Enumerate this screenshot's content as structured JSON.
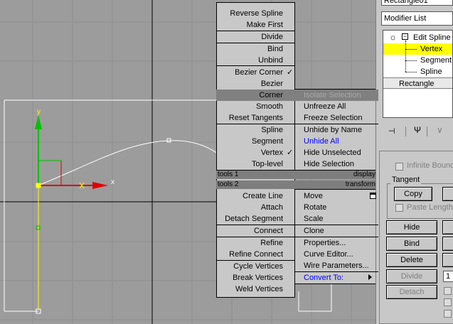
{
  "viewport": {
    "axis_x_label": "x",
    "axis_y_label": "y"
  },
  "quad_left": {
    "items_top": [
      {
        "label": "Reverse Spline",
        "checked": false
      },
      {
        "label": "Make First",
        "checked": false
      },
      {
        "label": "Divide",
        "checked": false
      },
      {
        "label": "Bind",
        "checked": false
      },
      {
        "label": "Unbind",
        "checked": false
      },
      {
        "label": "Bezier Corner",
        "checked": true
      },
      {
        "label": "Bezier",
        "checked": false
      },
      {
        "label": "Corner",
        "checked": false,
        "highlighted": true
      },
      {
        "label": "Smooth",
        "checked": false
      },
      {
        "label": "Reset Tangents",
        "checked": false
      },
      {
        "label": "Spline",
        "checked": false
      },
      {
        "label": "Segment",
        "checked": false
      },
      {
        "label": "Vertex",
        "checked": true
      },
      {
        "label": "Top-level",
        "checked": false
      }
    ],
    "header1_left": "tools 1",
    "header1_right": "display",
    "header2_left": "tools 2",
    "header2_right": "transform",
    "items_bottom": [
      {
        "label": "Create Line"
      },
      {
        "label": "Attach"
      },
      {
        "label": "Detach Segment"
      },
      {
        "label": "Connect"
      },
      {
        "label": "Refine"
      },
      {
        "label": "Refine Connect"
      },
      {
        "label": "Cycle Vertices"
      },
      {
        "label": "Break Vertices"
      },
      {
        "label": "Weld Vertices"
      }
    ]
  },
  "quad_right": {
    "display_items": [
      {
        "label": "Isolate Selection",
        "state": "disabled"
      },
      {
        "label": "Unfreeze All",
        "state": "normal"
      },
      {
        "label": "Freeze Selection",
        "state": "normal"
      },
      {
        "label": "Unhide by Name",
        "state": "normal"
      },
      {
        "label": "Unhide All",
        "state": "blue"
      },
      {
        "label": "Hide Unselected",
        "state": "normal"
      },
      {
        "label": "Hide Selection",
        "state": "normal"
      }
    ],
    "transform_items": [
      {
        "label": "Move"
      },
      {
        "label": "Rotate"
      },
      {
        "label": "Scale"
      },
      {
        "label": "Clone"
      },
      {
        "label": "Properties..."
      },
      {
        "label": "Curve Editor..."
      },
      {
        "label": "Wire Parameters..."
      },
      {
        "label": "Convert To:",
        "color": "blue"
      }
    ]
  },
  "panel": {
    "object_name": "Rectangle01",
    "modifier_list": "Modifier List",
    "stack": [
      {
        "label": "Edit Spline",
        "level": 0,
        "selected": false
      },
      {
        "label": "Vertex",
        "level": 1,
        "selected": true
      },
      {
        "label": "Segment",
        "level": 1,
        "selected": false
      },
      {
        "label": "Spline",
        "level": 1,
        "selected": false
      },
      {
        "label": "Rectangle",
        "level": -1,
        "selected": false
      }
    ],
    "infinite_bounds": "Infinite Bound",
    "tangent_group": "Tangent",
    "copy_button": "Copy",
    "paste_length": "Paste Length",
    "hide_button": "Hide",
    "bind_button": "Bind",
    "delete_button": "Delete",
    "divide_button": "Divide",
    "detach_button": "Detach",
    "divide_value": "1"
  },
  "colors": {
    "highlight_row": "#808080",
    "stack_selected": "#ffff00",
    "link_blue": "#0000ff",
    "axis_red": "#e00000",
    "axis_green": "#00c000"
  }
}
